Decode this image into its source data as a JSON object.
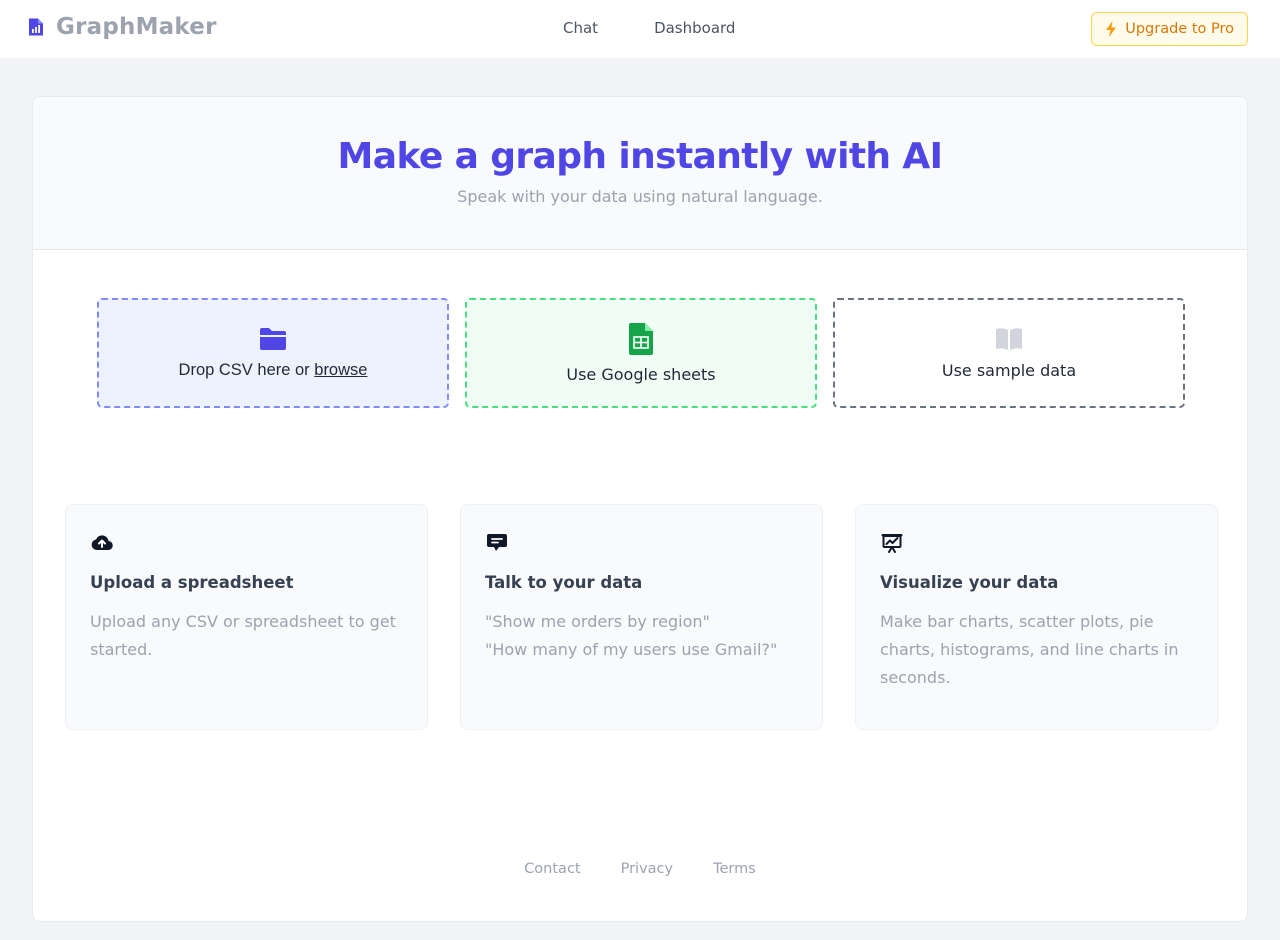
{
  "header": {
    "brand": "GraphMaker",
    "nav": [
      {
        "label": "Chat"
      },
      {
        "label": "Dashboard"
      }
    ],
    "upgrade_label": "Upgrade to Pro"
  },
  "hero": {
    "title": "Make a graph instantly with AI",
    "subtitle": "Speak with your data using natural language."
  },
  "sources": {
    "csv": {
      "prefix": "Drop CSV here or ",
      "link": "browse",
      "icon": "folder-icon"
    },
    "sheets": {
      "label": "Use Google sheets",
      "icon": "google-sheets-icon"
    },
    "sample": {
      "label": "Use sample data",
      "icon": "book-icon"
    }
  },
  "features": [
    {
      "icon": "cloud-upload-icon",
      "title": "Upload a spreadsheet",
      "lines": [
        "Upload any CSV or spreadsheet to get",
        "started."
      ]
    },
    {
      "icon": "chat-bubble-icon",
      "title": "Talk to your data",
      "lines": [
        "\"Show me orders by region\"",
        "\"How many of my users use Gmail?\""
      ]
    },
    {
      "icon": "presentation-chart-icon",
      "title": "Visualize your data",
      "lines": [
        "Make bar charts, scatter plots, pie",
        "charts, histograms, and line charts in",
        "seconds."
      ]
    }
  ],
  "footer": [
    {
      "label": "Contact"
    },
    {
      "label": "Privacy"
    },
    {
      "label": "Terms"
    }
  ],
  "colors": {
    "accent": "#4f46e5",
    "upgrade": "#d97706",
    "sheets_green": "#16a34a"
  }
}
